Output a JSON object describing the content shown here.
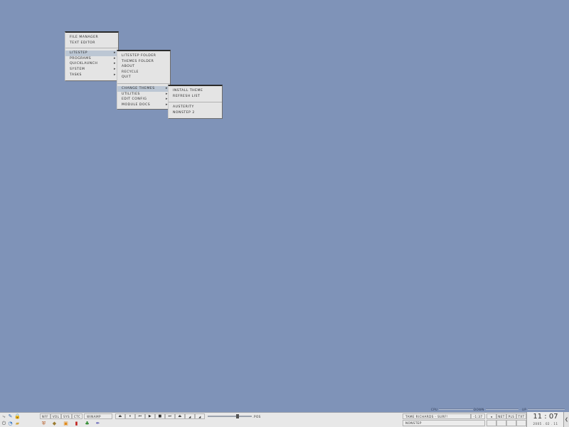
{
  "menus": {
    "main": [
      "File Manager",
      "Text Editor",
      "Litestep",
      "Programs",
      "Quicklaunch",
      "System",
      "Tasks"
    ],
    "litestep": [
      "Litestep Folder",
      "Themes Folder",
      "About",
      "Recycle",
      "Quit",
      "Change Themes",
      "Utilities",
      "Edit Config",
      "Module Docs"
    ],
    "themes": [
      "Install Theme",
      "Refresh List",
      "Austerity",
      "Nonstep 2"
    ]
  },
  "meters": {
    "cpu": "CPU",
    "down": "DOWN",
    "up": "UP"
  },
  "taskbar": {
    "nav": [
      "NFF",
      "VOL",
      "SYS",
      "CTC"
    ],
    "winamp_label": "WINAMP",
    "player_controls": [
      "⏏",
      "⏸",
      "⏮",
      "▶",
      "■",
      "⏭",
      "⏏",
      "vol-dn",
      "vol-up"
    ],
    "player_extra": ".pos",
    "track_title": "Tame Richards - Surf!",
    "track_time": "-1:37",
    "task_label": "NONSTEP",
    "net_buttons": [
      "NET",
      "PLS",
      "TXT"
    ],
    "clock_time": "11 : 07",
    "clock_date": "2005 . 02 . 11"
  },
  "colors": {
    "desktop": "#7f93b8",
    "menu_bg": "#e4e4e4",
    "highlight": "#bcc7d4"
  }
}
